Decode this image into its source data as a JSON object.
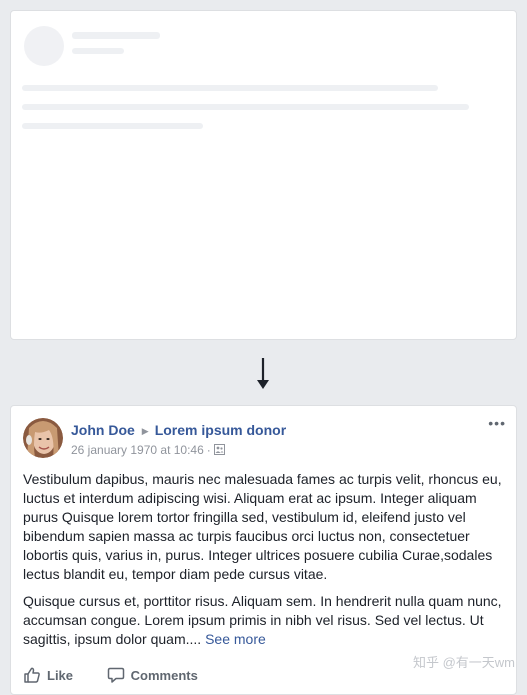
{
  "post": {
    "author": "John Doe",
    "target": "Lorem ipsum donor",
    "timestamp": "26 january 1970 at 10:46",
    "separator": "·",
    "more_label": "•••",
    "paragraph1": "Vestibulum dapibus, mauris nec malesuada fames ac turpis velit, rhoncus eu, luctus et interdum adipiscing wisi. Aliquam erat ac ipsum. Integer aliquam purus Quisque lorem tortor fringilla sed, vestibulum id, eleifend justo vel bibendum sapien massa ac turpis faucibus orci luctus non, consectetuer lobortis quis, varius in, purus. Integer ultrices posuere cubilia Curae,sodales lectus blandit eu, tempor diam pede cursus vitae.",
    "paragraph2": "Quisque cursus et, porttitor risus. Aliquam sem. In hendrerit nulla quam nunc, accumsan congue. Lorem ipsum primis in nibh vel risus. Sed vel lectus. Ut sagittis, ipsum dolor quam.... ",
    "see_more": "See more"
  },
  "actions": {
    "like": "Like",
    "comments": "Comments"
  },
  "watermark": "知乎 @有一天wm",
  "colors": {
    "link": "#365899",
    "background": "#e9ebee"
  },
  "icons": {
    "audience": "people-icon",
    "like": "thumbs-up-icon",
    "comment": "comment-icon",
    "arrow": "arrow-down-icon"
  }
}
